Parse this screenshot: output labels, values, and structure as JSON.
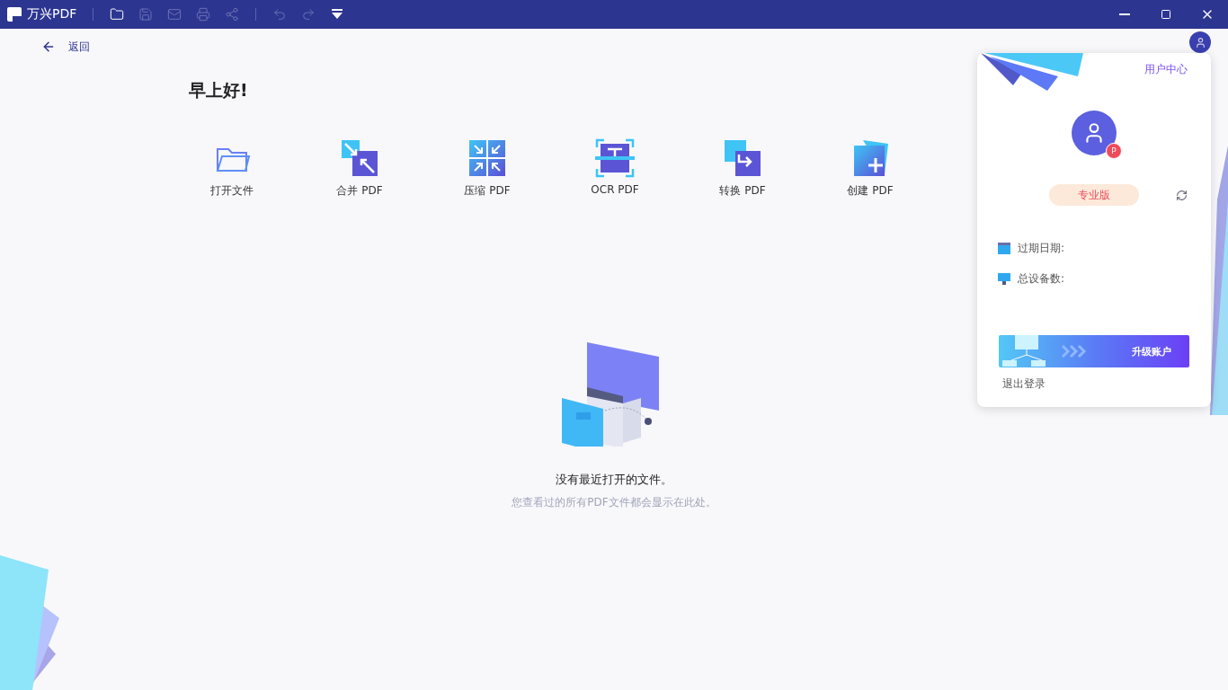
{
  "titlebar": {
    "logo": "万兴PDF",
    "tools": [
      {
        "kind": "folder",
        "disabled": false
      },
      {
        "kind": "save",
        "disabled": true
      },
      {
        "kind": "mail",
        "disabled": true
      },
      {
        "kind": "print",
        "disabled": true
      },
      {
        "kind": "share",
        "disabled": true
      },
      {
        "kind": "undo",
        "disabled": true
      },
      {
        "kind": "redo",
        "disabled": true
      },
      {
        "kind": "dropdown",
        "disabled": false
      }
    ]
  },
  "back": "返回",
  "greeting": "早上好!",
  "actions": [
    {
      "kind": "open",
      "label": "打开文件"
    },
    {
      "kind": "merge",
      "label": "合并 PDF"
    },
    {
      "kind": "compress",
      "label": "压缩 PDF"
    },
    {
      "kind": "ocr",
      "label": "OCR PDF"
    },
    {
      "kind": "convert",
      "label": "转换 PDF"
    },
    {
      "kind": "create",
      "label": "创建 PDF"
    }
  ],
  "empty": {
    "title": "没有最近打开的文件。",
    "subtitle": "您查看过的所有PDF文件都会显示在此处。"
  },
  "account_popup": {
    "user_center": "用户中心",
    "badge": "P",
    "plan": "专业版",
    "info": [
      {
        "kind": "calendar",
        "label": "过期日期:"
      },
      {
        "kind": "monitor",
        "label": "总设备数:"
      }
    ],
    "upgrade": "升级账户",
    "logout": "退出登录"
  }
}
